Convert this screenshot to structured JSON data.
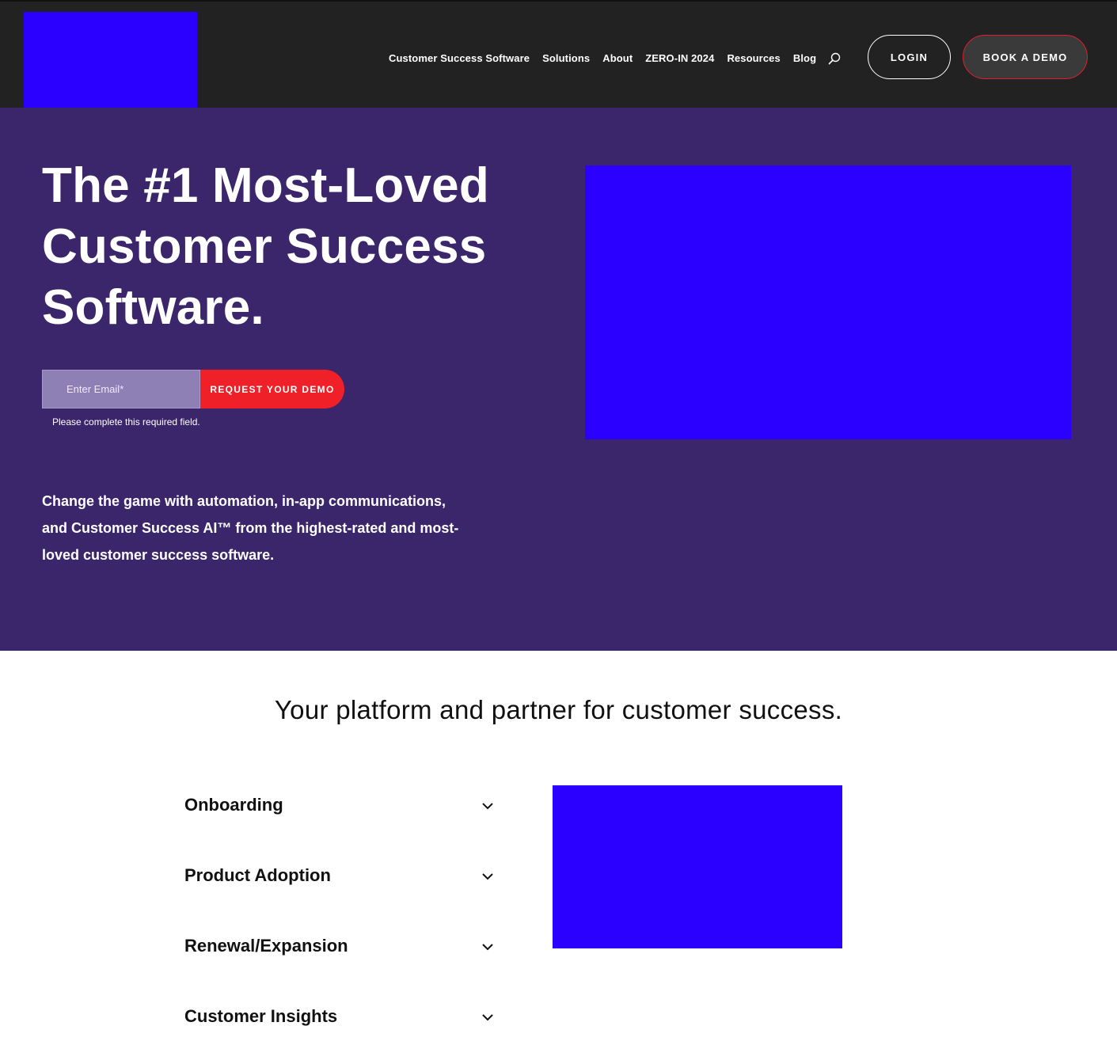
{
  "colors": {
    "header_bg": "#222222",
    "hero_bg": "#3b266b",
    "accent_red": "#ef2027",
    "placeholder_blue": "#2b00ff"
  },
  "header": {
    "logo": "logo-placeholder",
    "nav": [
      {
        "label": "Customer Success Software"
      },
      {
        "label": "Solutions"
      },
      {
        "label": "About"
      },
      {
        "label": "ZERO-IN 2024"
      },
      {
        "label": "Resources"
      },
      {
        "label": "Blog"
      }
    ],
    "search_icon": "search-icon",
    "login_label": "LOGIN",
    "demo_label": "BOOK A DEMO"
  },
  "hero": {
    "title_line1": "The #1 Most-Loved",
    "title_line2": "Customer Success",
    "title_line3": "Software.",
    "email_placeholder": "Enter Email*",
    "request_label": "REQUEST YOUR DEMO",
    "error": "Please complete this required field.",
    "subtitle": "Change the game with automation, in-app communications, and Customer Success AI™ from the highest-rated and most-loved customer success software."
  },
  "platform": {
    "title": "Your platform and partner for customer success.",
    "items": [
      {
        "label": "Onboarding",
        "icon": "chevron-down-icon"
      },
      {
        "label": "Product Adoption",
        "icon": "chevron-down-icon"
      },
      {
        "label": "Renewal/Expansion",
        "icon": "chevron-down-icon"
      },
      {
        "label": "Customer Insights",
        "icon": "chevron-down-icon"
      }
    ]
  }
}
